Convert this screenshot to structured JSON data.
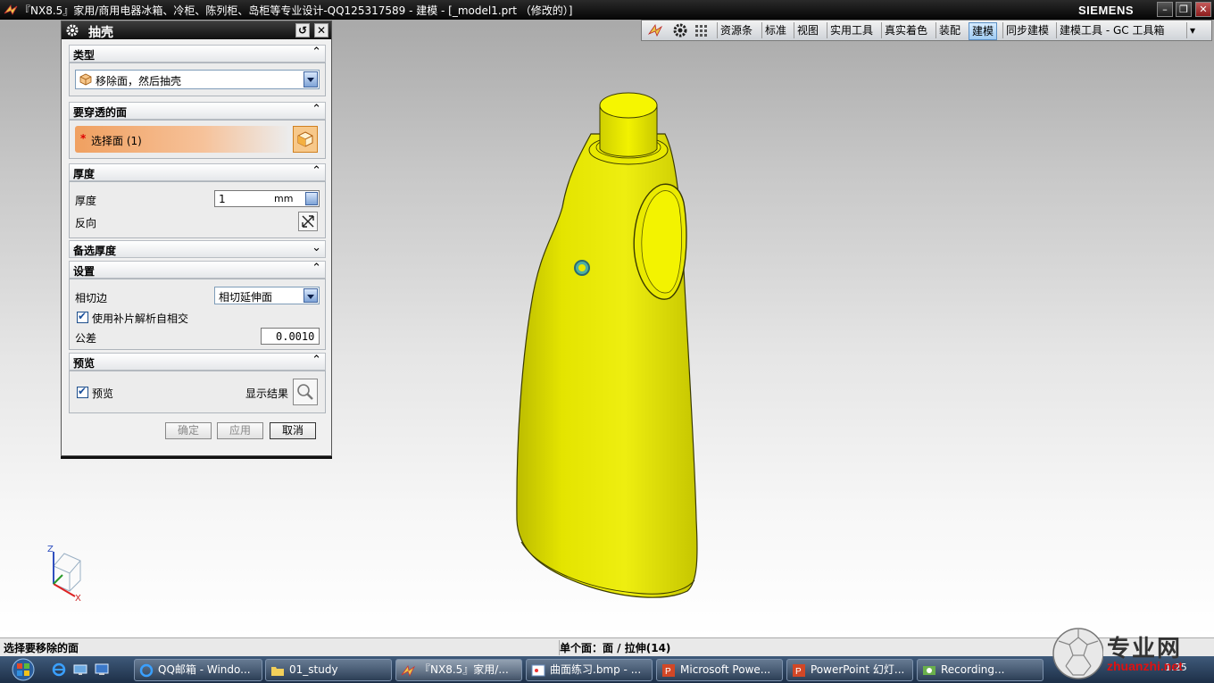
{
  "window": {
    "title": "『NX8.5』家用/商用电器冰箱、冷柜、陈列柜、岛柜等专业设计-QQ125317589 - 建模 - [_model1.prt （修改的）]",
    "brand": "SIEMENS",
    "controls": {
      "minimize": "–",
      "restore": "❐",
      "close": "✕"
    }
  },
  "ribbon": {
    "tabs": [
      "资源条",
      "标准",
      "视图",
      "实用工具",
      "真实着色",
      "装配",
      "建模",
      "同步建模",
      "建模工具 - GC 工具箱"
    ],
    "active_tab": "建模"
  },
  "dialog": {
    "title": "抽壳",
    "reset_icon": "↺",
    "close_icon": "✕",
    "sections": {
      "type": {
        "label": "类型",
        "chevron": "⌃",
        "value": "移除面，然后抽壳"
      },
      "faces": {
        "label": "要穿透的面",
        "chevron": "⌃",
        "select_label": "选择面 (1)",
        "required_mark": "*"
      },
      "thickness": {
        "label": "厚度",
        "chevron": "⌃",
        "thickness_label": "厚度",
        "thickness_value": "1",
        "unit": "mm",
        "reverse_label": "反向"
      },
      "alt_thickness": {
        "label": "备选厚度",
        "chevron": "⌄"
      },
      "settings": {
        "label": "设置",
        "chevron": "⌃",
        "tangent_label": "相切边",
        "tangent_value": "相切延伸面",
        "patch_label": "使用补片解析自相交",
        "tolerance_label": "公差",
        "tolerance_value": "0.0010"
      },
      "preview": {
        "label": "预览",
        "chevron": "⌃",
        "preview_label": "预览",
        "show_result_label": "显示结果"
      }
    },
    "buttons": {
      "ok": "确定",
      "apply": "应用",
      "cancel": "取消"
    }
  },
  "triad": {
    "z": "Z",
    "x": "X"
  },
  "status": {
    "prompt": "选择要移除的面",
    "info": "单个面：面 / 拉伸(14)"
  },
  "taskbar": {
    "tasks": [
      {
        "label": "QQ邮箱 - Windo...",
        "icon": "ie-icon"
      },
      {
        "label": "01_study",
        "icon": "folder-icon"
      },
      {
        "label": "『NX8.5』家用/...",
        "icon": "nx-icon"
      },
      {
        "label": "曲面练习.bmp - ...",
        "icon": "paint-icon"
      },
      {
        "label": "Microsoft Powe...",
        "icon": "powerpoint-icon"
      },
      {
        "label": "PowerPoint 幻灯...",
        "icon": "powerpoint-icon"
      },
      {
        "label": "Recording...",
        "icon": "recorder-icon"
      }
    ],
    "clock": "1:25"
  },
  "watermark": {
    "text_cn": "专业网",
    "text_url": "zhuanzhi.net"
  },
  "colors": {
    "part_yellow": "#e8e800",
    "active_tab": "#9fcbf2",
    "select_highlight": "#f0a060"
  }
}
